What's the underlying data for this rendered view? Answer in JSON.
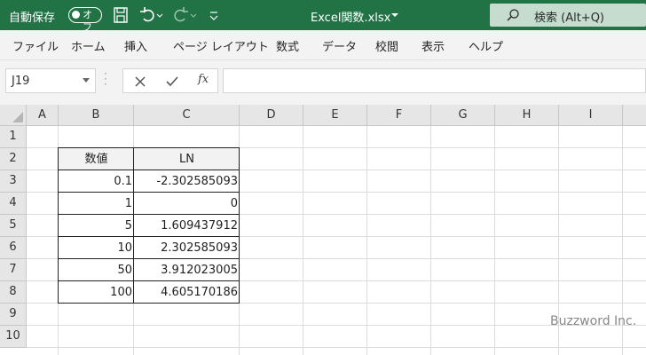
{
  "titlebar": {
    "autosave_label": "自動保存",
    "autosave_state": "オフ",
    "filename": "Excel関数.xlsx",
    "search_label": "検索 (Alt+Q)",
    "accent_color": "#217346"
  },
  "ribbon": {
    "tabs": [
      "ファイル",
      "ホーム",
      "挿入",
      "ページ レイアウト",
      "数式",
      "データ",
      "校閲",
      "表示",
      "ヘルプ"
    ]
  },
  "formula_bar": {
    "name_box": "J19",
    "formula": ""
  },
  "sheet": {
    "columns": [
      "A",
      "B",
      "C",
      "D",
      "E",
      "F",
      "G",
      "H",
      "I"
    ],
    "rows": [
      "1",
      "2",
      "3",
      "4",
      "5",
      "6",
      "7",
      "8",
      "9",
      "10"
    ],
    "table": {
      "headers": [
        "数値",
        "LN"
      ],
      "rows": [
        [
          "0.1",
          "-2.302585093"
        ],
        [
          "1",
          "0"
        ],
        [
          "5",
          "1.609437912"
        ],
        [
          "10",
          "2.302585093"
        ],
        [
          "50",
          "3.912023005"
        ],
        [
          "100",
          "4.605170186"
        ]
      ]
    }
  },
  "watermark": "Buzzword Inc."
}
